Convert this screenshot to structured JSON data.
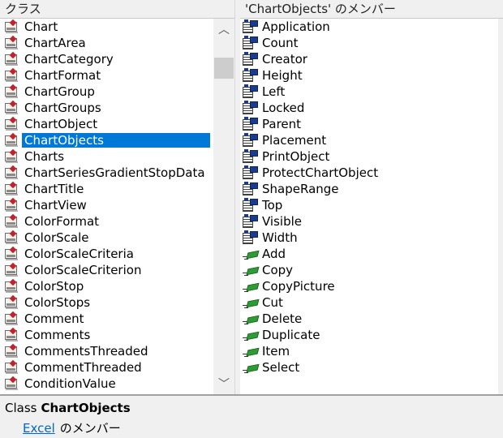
{
  "left_pane": {
    "header": "クラス",
    "selected": "ChartObjects",
    "classes": [
      "Chart",
      "ChartArea",
      "ChartCategory",
      "ChartFormat",
      "ChartGroup",
      "ChartGroups",
      "ChartObject",
      "ChartObjects",
      "Charts",
      "ChartSeriesGradientStopData",
      "ChartTitle",
      "ChartView",
      "ColorFormat",
      "ColorScale",
      "ColorScaleCriteria",
      "ColorScaleCriterion",
      "ColorStop",
      "ColorStops",
      "Comment",
      "Comments",
      "CommentsThreaded",
      "CommentThreaded",
      "ConditionValue"
    ],
    "class_icon": "class-module-icon",
    "scroll_up_glyph": "︿",
    "scroll_down_glyph": "﹀"
  },
  "right_pane": {
    "header": "'ChartObjects' のメンバー",
    "members": [
      {
        "name": "Application",
        "kind": "property"
      },
      {
        "name": "Count",
        "kind": "property"
      },
      {
        "name": "Creator",
        "kind": "property"
      },
      {
        "name": "Height",
        "kind": "property"
      },
      {
        "name": "Left",
        "kind": "property"
      },
      {
        "name": "Locked",
        "kind": "property"
      },
      {
        "name": "Parent",
        "kind": "property"
      },
      {
        "name": "Placement",
        "kind": "property"
      },
      {
        "name": "PrintObject",
        "kind": "property"
      },
      {
        "name": "ProtectChartObject",
        "kind": "property"
      },
      {
        "name": "ShapeRange",
        "kind": "property"
      },
      {
        "name": "Top",
        "kind": "property"
      },
      {
        "name": "Visible",
        "kind": "property"
      },
      {
        "name": "Width",
        "kind": "property"
      },
      {
        "name": "Add",
        "kind": "method"
      },
      {
        "name": "Copy",
        "kind": "method"
      },
      {
        "name": "CopyPicture",
        "kind": "method"
      },
      {
        "name": "Cut",
        "kind": "method"
      },
      {
        "name": "Delete",
        "kind": "method"
      },
      {
        "name": "Duplicate",
        "kind": "method"
      },
      {
        "name": "Item",
        "kind": "method"
      },
      {
        "name": "Select",
        "kind": "method"
      }
    ]
  },
  "details": {
    "kind": "Class",
    "name": "ChartObjects",
    "library_link": "Excel",
    "member_of": "のメンバー"
  },
  "colors": {
    "selection": "#0078d7",
    "link": "#0066cc"
  }
}
